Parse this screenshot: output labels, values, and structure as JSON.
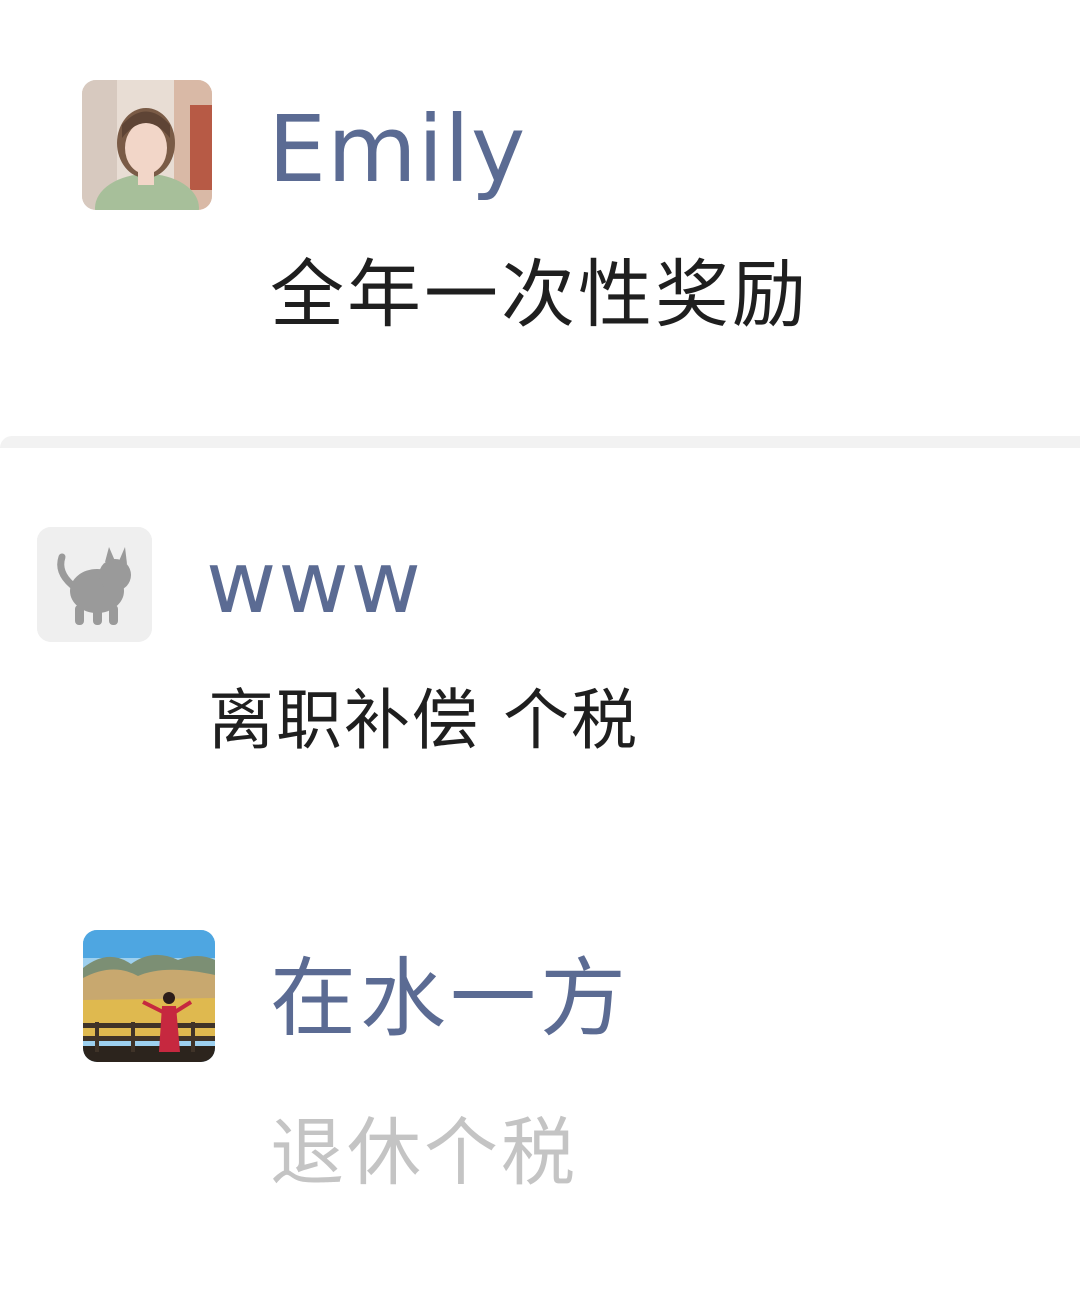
{
  "comments": [
    {
      "name": "Emily",
      "text": "全年一次性奖励",
      "avatar_icon": "person-portrait-avatar"
    },
    {
      "name": "www",
      "text": "离职补偿 个税",
      "avatar_icon": "cat-avatar"
    },
    {
      "name": "在水一方",
      "text": "退休个税",
      "avatar_icon": "landscape-avatar"
    }
  ],
  "colors": {
    "name": "#5b6b93",
    "text": "#1f1f1f",
    "muted_text": "#c4c4c4",
    "background": "#ffffff",
    "divider": "#f2f2f2"
  }
}
